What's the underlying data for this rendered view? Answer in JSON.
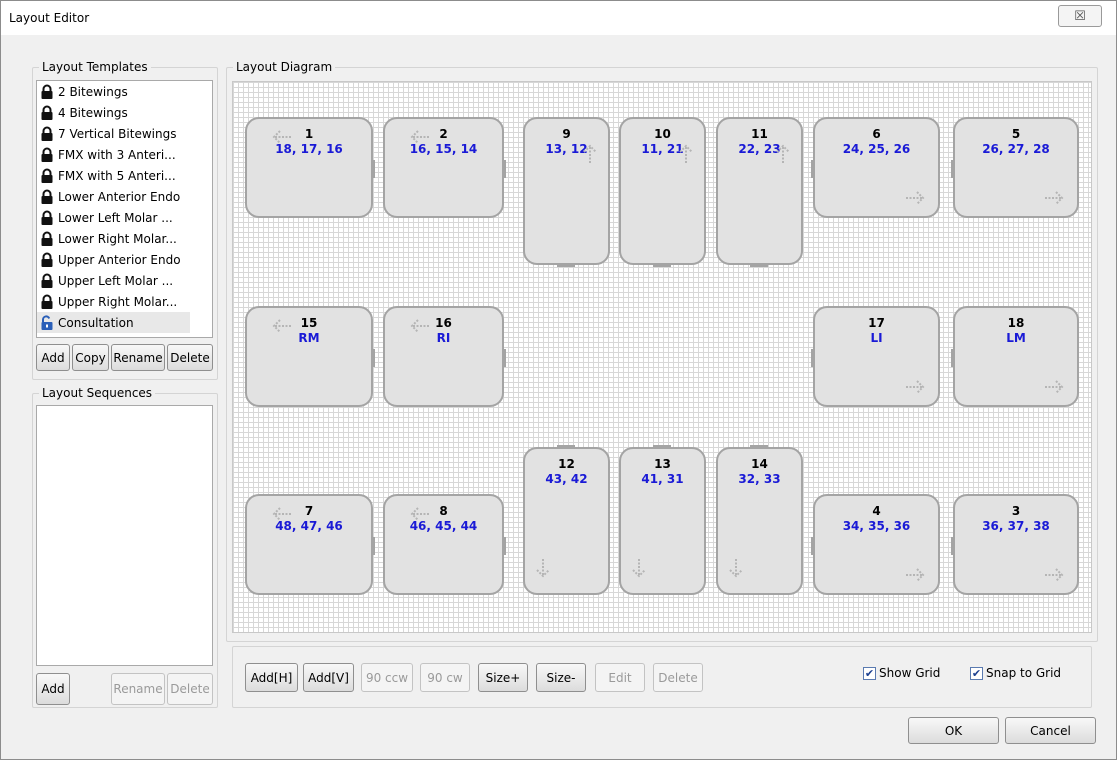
{
  "window": {
    "title": "Layout Editor",
    "close_glyph": "☒"
  },
  "templates": {
    "label": "Layout Templates",
    "items": [
      {
        "label": "2 Bitewings",
        "locked": true
      },
      {
        "label": "4 Bitewings",
        "locked": true
      },
      {
        "label": "7 Vertical Bitewings",
        "locked": true
      },
      {
        "label": "FMX with 3 Anteri...",
        "locked": true
      },
      {
        "label": "FMX with 5 Anteri...",
        "locked": true
      },
      {
        "label": "Lower Anterior Endo",
        "locked": true
      },
      {
        "label": "Lower Left Molar ...",
        "locked": true
      },
      {
        "label": "Lower Right Molar...",
        "locked": true
      },
      {
        "label": "Upper Anterior Endo",
        "locked": true
      },
      {
        "label": "Upper Left Molar ...",
        "locked": true
      },
      {
        "label": "Upper Right Molar...",
        "locked": true
      },
      {
        "label": "Consultation",
        "locked": false,
        "selected": true
      }
    ],
    "buttons": {
      "add": "Add",
      "copy": "Copy",
      "rename": "Rename",
      "delete": "Delete"
    }
  },
  "sequences": {
    "label": "Layout Sequences",
    "buttons": {
      "add": "Add",
      "rename": "Rename",
      "delete": "Delete"
    }
  },
  "diagram": {
    "label": "Layout Diagram",
    "films": [
      {
        "num": "1",
        "teeth": "18, 17, 16",
        "arrow": "left"
      },
      {
        "num": "2",
        "teeth": "16, 15, 14",
        "arrow": "left"
      },
      {
        "num": "9",
        "teeth": "13, 12",
        "arrow": "up"
      },
      {
        "num": "10",
        "teeth": "11, 21",
        "arrow": "up"
      },
      {
        "num": "11",
        "teeth": "22, 23",
        "arrow": "up"
      },
      {
        "num": "6",
        "teeth": "24, 25, 26",
        "arrow": "right"
      },
      {
        "num": "5",
        "teeth": "26, 27, 28",
        "arrow": "right"
      },
      {
        "num": "15",
        "teeth": "RM",
        "arrow": "left"
      },
      {
        "num": "16",
        "teeth": "RI",
        "arrow": "left"
      },
      {
        "num": "17",
        "teeth": "LI",
        "arrow": "right"
      },
      {
        "num": "18",
        "teeth": "LM",
        "arrow": "right"
      },
      {
        "num": "12",
        "teeth": "43, 42",
        "arrow": "down"
      },
      {
        "num": "13",
        "teeth": "41, 31",
        "arrow": "down"
      },
      {
        "num": "14",
        "teeth": "32, 33",
        "arrow": "down"
      },
      {
        "num": "7",
        "teeth": "48, 47, 46",
        "arrow": "left"
      },
      {
        "num": "8",
        "teeth": "46, 45, 44",
        "arrow": "left"
      },
      {
        "num": "4",
        "teeth": "34, 35, 36",
        "arrow": "right"
      },
      {
        "num": "3",
        "teeth": "36, 37, 38",
        "arrow": "right"
      }
    ]
  },
  "toolbar": {
    "add_h": "Add[H]",
    "add_v": "Add[V]",
    "ccw": "90 ccw",
    "cw": "90 cw",
    "size_plus": "Size+",
    "size_minus": "Size-",
    "edit": "Edit",
    "delete": "Delete",
    "show_grid": "Show Grid",
    "snap_to_grid": "Snap to Grid",
    "show_grid_checked": true,
    "snap_checked": true
  },
  "footer": {
    "ok": "OK",
    "cancel": "Cancel"
  }
}
